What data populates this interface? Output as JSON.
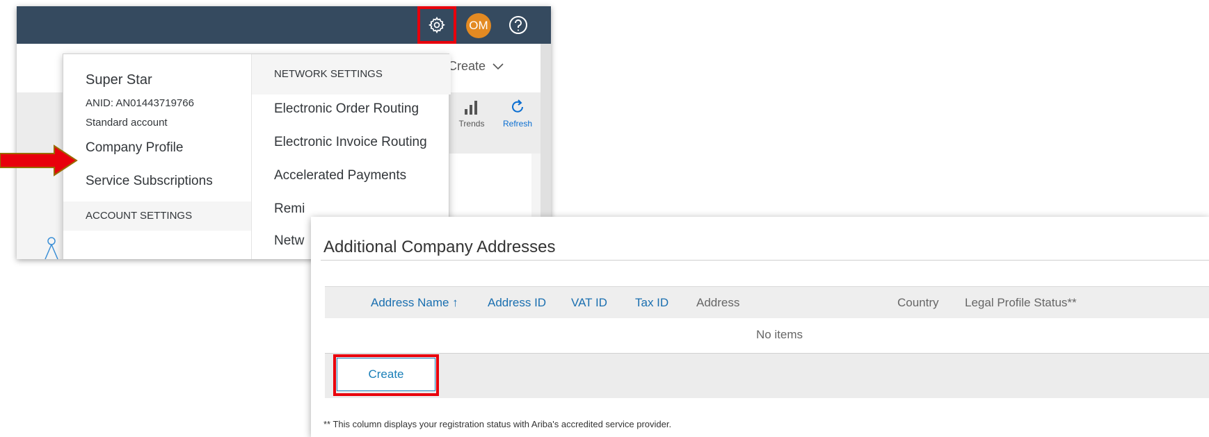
{
  "top_screenshot": {
    "header": {
      "avatar_initials": "OM",
      "settings_icon": "gear-icon",
      "help_icon": "question-icon"
    },
    "subheader": {
      "create_label": "Create"
    },
    "toolbar": {
      "trends_label": "Trends",
      "refresh_label": "Refresh"
    },
    "dropdown": {
      "account_name": "Super Star",
      "anid": "ANID: AN01443719766",
      "account_type": "Standard account",
      "left_items": [
        {
          "label": "Company Profile"
        },
        {
          "label": "Service Subscriptions"
        }
      ],
      "account_settings_heading": "ACCOUNT SETTINGS",
      "network_settings_heading": "NETWORK SETTINGS",
      "right_items": [
        {
          "label": "Electronic Order Routing"
        },
        {
          "label": "Electronic Invoice Routing"
        },
        {
          "label": "Accelerated Payments"
        },
        {
          "label": "Remi"
        },
        {
          "label": "Netw"
        }
      ]
    }
  },
  "bottom_screenshot": {
    "title": "Additional Company Addresses",
    "columns": [
      {
        "label": "Address Name ↑"
      },
      {
        "label": "Address ID"
      },
      {
        "label": "VAT ID"
      },
      {
        "label": "Tax ID"
      },
      {
        "label": "Address"
      },
      {
        "label": "Country"
      },
      {
        "label": "Legal Profile Status**"
      }
    ],
    "empty_message": "No items",
    "create_button_label": "Create",
    "footnote": "** This column displays your registration status with Ariba's accredited service provider."
  },
  "colors": {
    "header_bg": "#354a5f",
    "avatar_bg": "#e38a22",
    "highlight_red": "#e8000c",
    "link_blue": "#1a6fb0"
  }
}
